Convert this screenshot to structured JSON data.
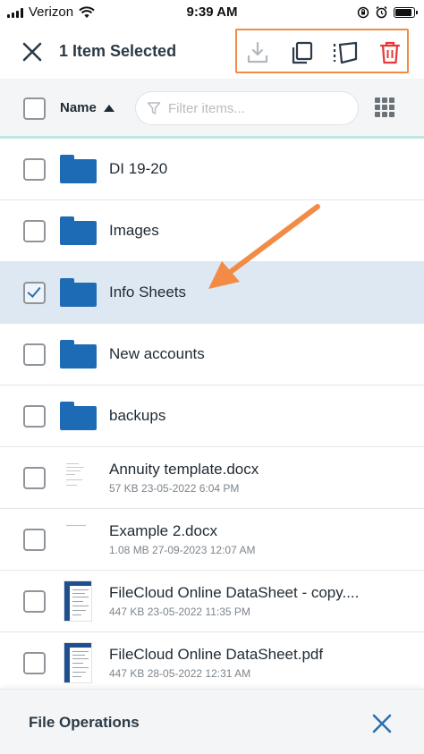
{
  "status_bar": {
    "carrier": "Verizon",
    "time": "9:39 AM"
  },
  "header": {
    "title": "1 Item Selected",
    "toolbar_icons": [
      "download-icon",
      "copy-icon",
      "move-icon",
      "trash-icon"
    ],
    "highlight_color": "#f28b45",
    "delete_color": "#e5393a"
  },
  "filter_bar": {
    "sort_label": "Name",
    "sort_direction": "ascending",
    "filter_placeholder": "Filter items...",
    "view_toggle_icon": "grid-view-icon"
  },
  "items": [
    {
      "name": "DI 19-20",
      "type": "folder",
      "selected": false
    },
    {
      "name": "Images",
      "type": "folder",
      "selected": false
    },
    {
      "name": "Info Sheets",
      "type": "folder",
      "selected": true
    },
    {
      "name": "New accounts",
      "type": "folder",
      "selected": false
    },
    {
      "name": "backups",
      "type": "folder",
      "selected": false
    },
    {
      "name": "Annuity template.docx",
      "type": "file",
      "meta": "57 KB 23-05-2022 6:04 PM",
      "selected": false
    },
    {
      "name": "Example 2.docx",
      "type": "file",
      "meta": "1.08 MB 27-09-2023 12:07 AM",
      "selected": false
    },
    {
      "name": "FileCloud Online DataSheet - copy....",
      "type": "file",
      "meta": "447 KB 23-05-2022 11:35 PM",
      "selected": false
    },
    {
      "name": "FileCloud Online DataSheet.pdf",
      "type": "file",
      "meta": "447 KB 28-05-2022 12:31 AM",
      "selected": false
    }
  ],
  "colors": {
    "folder": "#1e6bb5",
    "selected_row": "#dde8f2",
    "annotation_arrow": "#f28b45",
    "accent": "#2b6fb0"
  },
  "bottom_sheet": {
    "title": "File Operations"
  }
}
